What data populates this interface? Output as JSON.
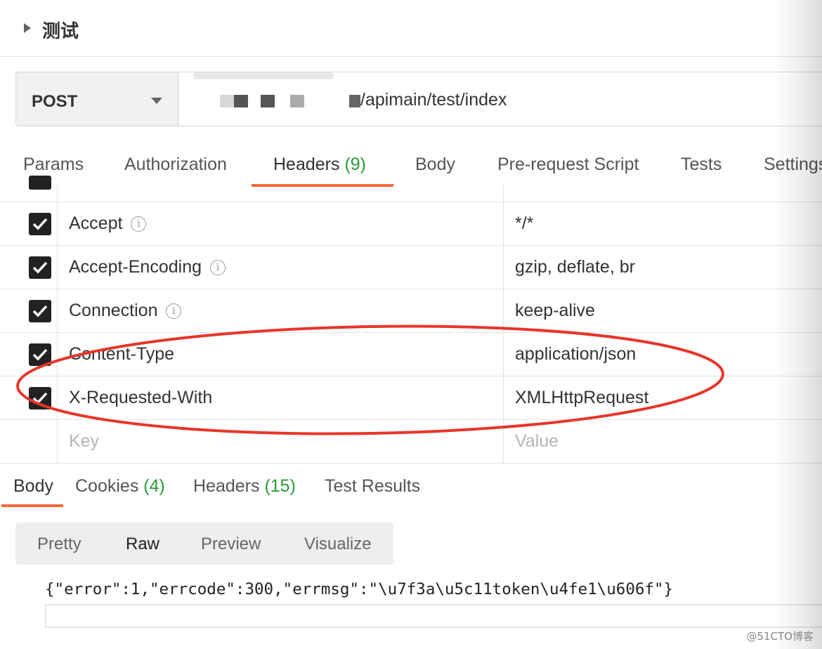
{
  "collection": {
    "title": "测试"
  },
  "request": {
    "method": "POST",
    "url": "/apimain/test/index"
  },
  "request_tabs": [
    {
      "label": "Params"
    },
    {
      "label": "Authorization"
    },
    {
      "label": "Headers",
      "count": "(9)"
    },
    {
      "label": "Body"
    },
    {
      "label": "Pre-request Script"
    },
    {
      "label": "Tests"
    },
    {
      "label": "Settings"
    }
  ],
  "headers": [
    {
      "key": "Accept",
      "value": "*/*",
      "checked": true,
      "info": "i"
    },
    {
      "key": "Accept-Encoding",
      "value": "gzip, deflate, br",
      "checked": true,
      "info": "i"
    },
    {
      "key": "Connection",
      "value": "keep-alive",
      "checked": true,
      "info": "i"
    },
    {
      "key": "Content-Type",
      "value": "application/json",
      "checked": true
    },
    {
      "key": "X-Requested-With",
      "value": "XMLHttpRequest",
      "checked": true
    }
  ],
  "new_header": {
    "key_placeholder": "Key",
    "value_placeholder": "Value"
  },
  "response_tabs": [
    {
      "label": "Body"
    },
    {
      "label": "Cookies",
      "count": "(4)"
    },
    {
      "label": "Headers",
      "count": "(15)"
    },
    {
      "label": "Test Results"
    }
  ],
  "view_modes": [
    {
      "label": "Pretty"
    },
    {
      "label": "Raw"
    },
    {
      "label": "Preview"
    },
    {
      "label": "Visualize"
    }
  ],
  "response": {
    "body": "{\"error\":1,\"errcode\":300,\"errmsg\":\"\\u7f3a\\u5c11token\\u4fe1\\u606f\"}"
  },
  "watermark": "@51CTO博客",
  "colors": {
    "accent": "#f26b3a",
    "count_green": "#2a9a3a",
    "annotation_red": "#e8352a"
  }
}
